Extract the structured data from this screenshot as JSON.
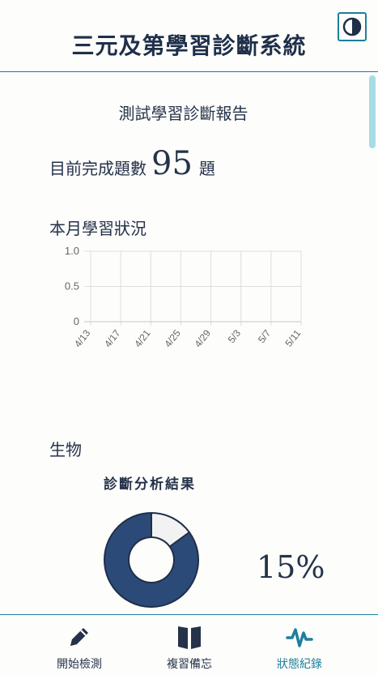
{
  "header": {
    "title": "三元及第學習診斷系統",
    "theme_toggle_icon": "contrast-icon"
  },
  "report": {
    "title": "測試學習診斷報告",
    "completed_label": "目前完成題數",
    "completed_count": "95",
    "completed_unit": "題"
  },
  "monthly": {
    "title": "本月學習狀況"
  },
  "subject": {
    "name": "生物",
    "analysis_title": "診斷分析結果",
    "percent": "15%"
  },
  "colors": {
    "accent": "#1e7f9c",
    "navy": "#2c4a78",
    "donut_light": "#f2f2f2"
  },
  "chart_data": [
    {
      "type": "line",
      "title": "",
      "xlabel": "",
      "ylabel": "",
      "x": [
        "4/13",
        "4/17",
        "4/21",
        "4/25",
        "4/29",
        "5/3",
        "5/7",
        "5/11"
      ],
      "y_ticks": [
        "1.0",
        "0.5",
        "0"
      ],
      "ylim": [
        0,
        1
      ],
      "grid": true,
      "series": [
        {
          "values": []
        }
      ]
    },
    {
      "type": "pie",
      "title": "診斷分析結果",
      "values": [
        15,
        85
      ],
      "colors": [
        "#f2f2f2",
        "#2c4a78"
      ],
      "label": "15%"
    }
  ],
  "nav": {
    "items": [
      {
        "label": "開始檢測",
        "icon": "pencil-icon",
        "active": false
      },
      {
        "label": "複習備忘",
        "icon": "book-icon",
        "active": false
      },
      {
        "label": "狀態紀錄",
        "icon": "activity-icon",
        "active": true
      }
    ]
  }
}
